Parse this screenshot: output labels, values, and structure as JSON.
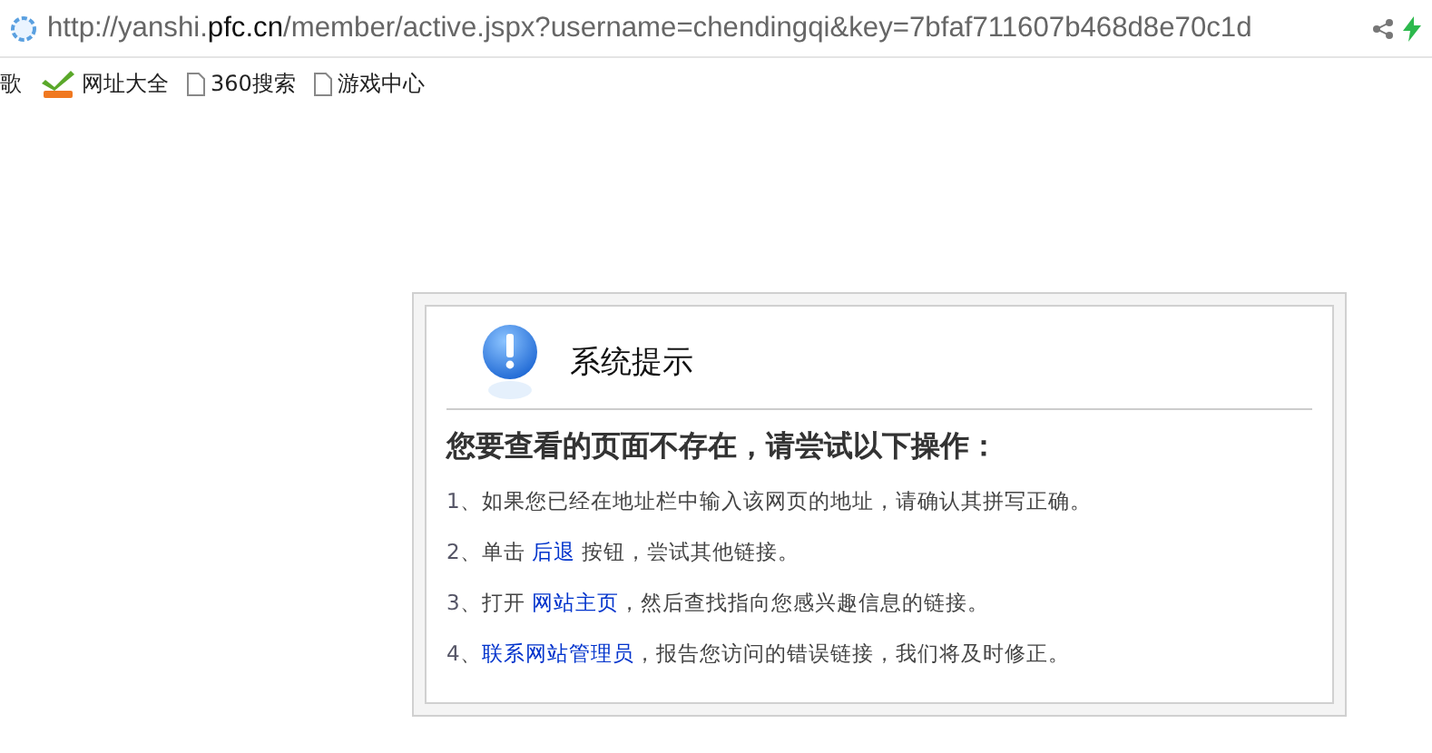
{
  "address_bar": {
    "url_prefix": "http://yanshi.",
    "url_domain": "pfc.cn",
    "url_path": "/member/active.jspx?username=chendingqi&key=7bfaf711607b468d8e70c1d"
  },
  "bookmarks": [
    {
      "kind": "cut",
      "label": "歌"
    },
    {
      "kind": "hao",
      "label": "网址大全"
    },
    {
      "kind": "page",
      "label": "360搜索"
    },
    {
      "kind": "page",
      "label": "游戏中心"
    }
  ],
  "notice": {
    "title": "系统提示",
    "heading": "您要查看的页面不存在，请尝试以下操作：",
    "steps": [
      {
        "number": "1",
        "parts": [
          {
            "kind": "text",
            "text": "、如果您已经在地址栏中输入该网页的地址，请确认其拼写正确。"
          }
        ]
      },
      {
        "number": "2",
        "parts": [
          {
            "kind": "text",
            "text": "、单击 "
          },
          {
            "kind": "link",
            "text": "后退"
          },
          {
            "kind": "text",
            "text": " 按钮，尝试其他链接。"
          }
        ]
      },
      {
        "number": "3",
        "parts": [
          {
            "kind": "text",
            "text": "、打开 "
          },
          {
            "kind": "link",
            "text": "网站主页"
          },
          {
            "kind": "text",
            "text": "，然后查找指向您感兴趣信息的链接。"
          }
        ]
      },
      {
        "number": "4",
        "parts": [
          {
            "kind": "text",
            "text": "、"
          },
          {
            "kind": "link",
            "text": "联系网站管理员"
          },
          {
            "kind": "text",
            "text": "，报告您访问的错误链接，我们将及时修正。"
          }
        ]
      }
    ]
  }
}
